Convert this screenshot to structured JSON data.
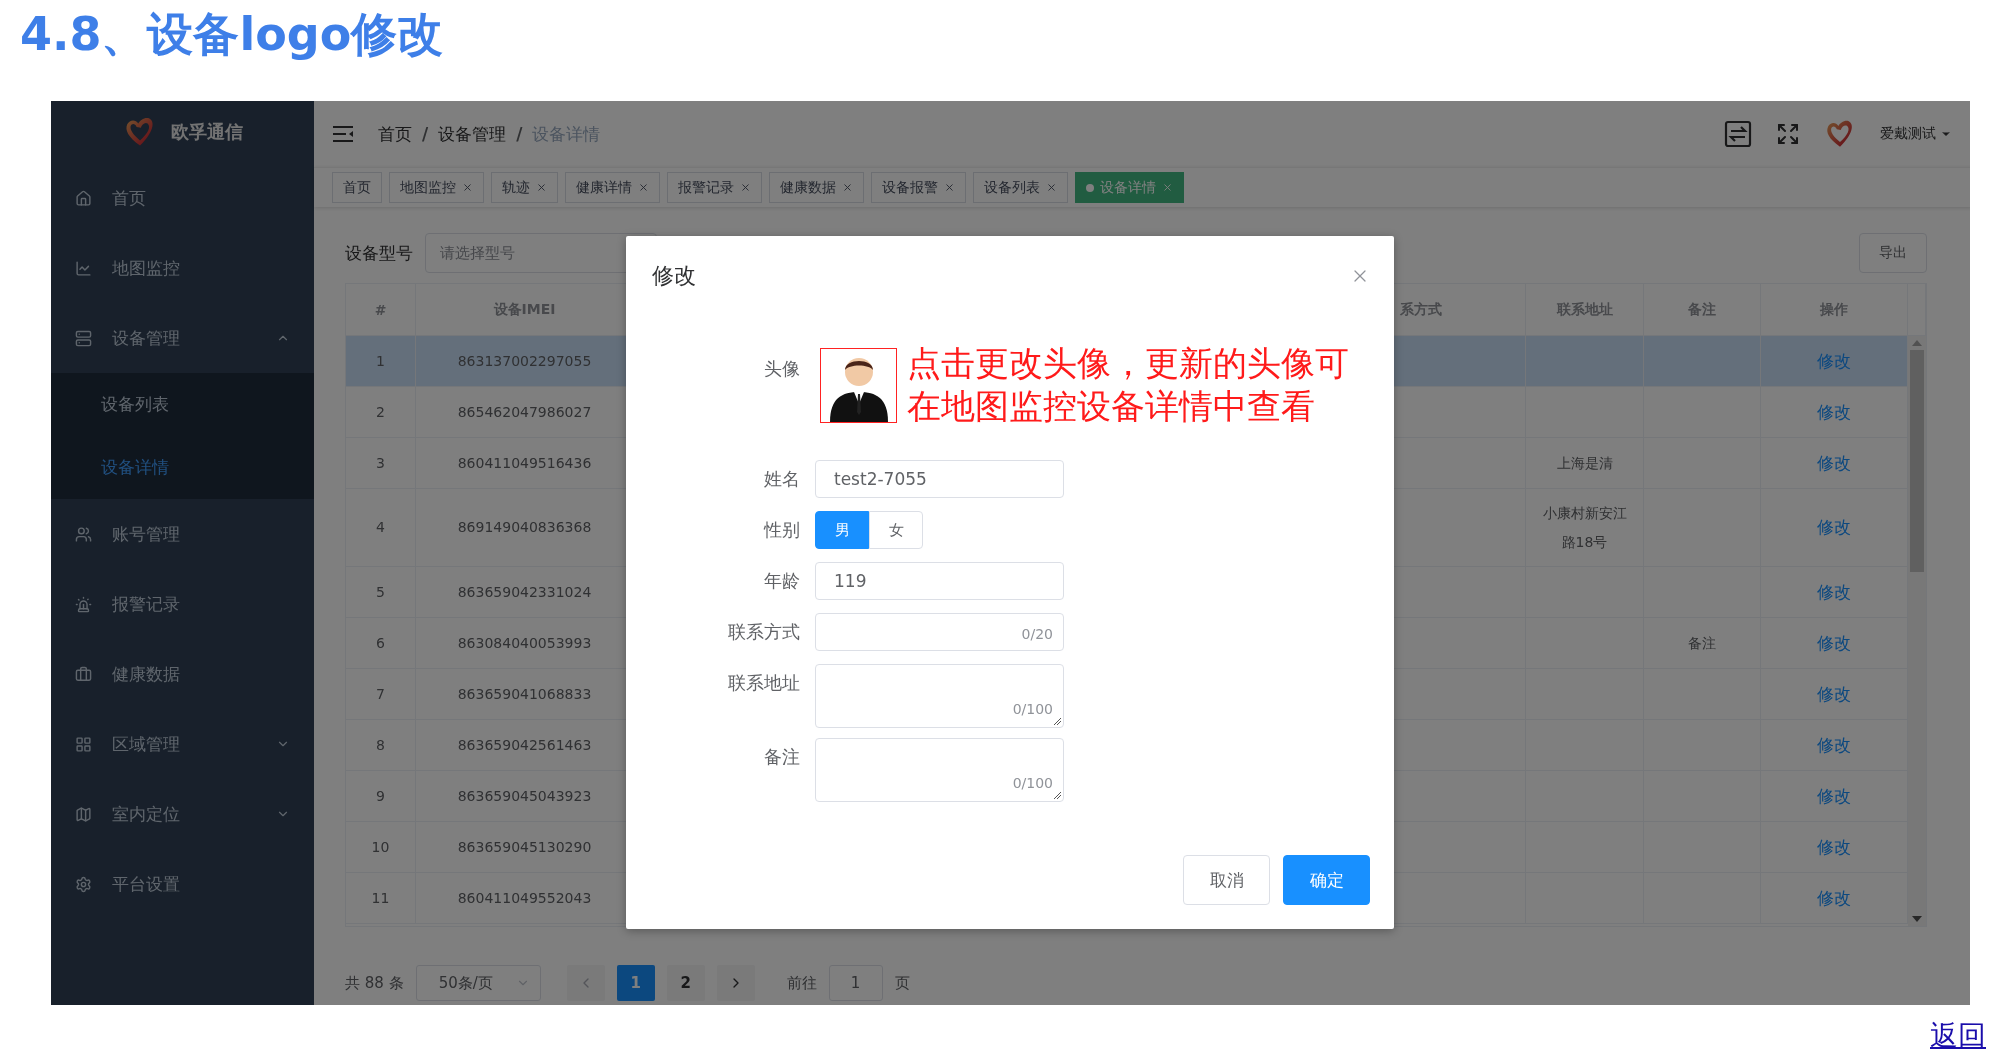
{
  "heading": "4.8、设备logo修改",
  "app": {
    "brand": "欧孚通信",
    "menu": [
      {
        "label": "首页",
        "selected": false
      },
      {
        "label": "地图监控",
        "selected": false
      },
      {
        "label": "设备管理",
        "selected": false,
        "expanded": true,
        "children": [
          {
            "label": "设备列表",
            "selected": false
          },
          {
            "label": "设备详情",
            "selected": true
          }
        ]
      },
      {
        "label": "账号管理",
        "selected": false
      },
      {
        "label": "报警记录",
        "selected": false
      },
      {
        "label": "健康数据",
        "selected": false
      },
      {
        "label": "区域管理",
        "selected": false,
        "expanded": false
      },
      {
        "label": "室内定位",
        "selected": false,
        "expanded": false
      },
      {
        "label": "平台设置",
        "selected": false
      }
    ],
    "breadcrumb": {
      "separator": "/",
      "items": [
        "首页",
        "设备管理",
        "设备详情"
      ]
    },
    "user": {
      "name": "爱戴测试"
    },
    "tabs": [
      {
        "label": "首页",
        "closable": false,
        "selected": false
      },
      {
        "label": "地图监控",
        "closable": true,
        "selected": false
      },
      {
        "label": "轨迹",
        "closable": true,
        "selected": false
      },
      {
        "label": "健康详情",
        "closable": true,
        "selected": false
      },
      {
        "label": "报警记录",
        "closable": true,
        "selected": false
      },
      {
        "label": "健康数据",
        "closable": true,
        "selected": false
      },
      {
        "label": "设备报警",
        "closable": true,
        "selected": false
      },
      {
        "label": "设备列表",
        "closable": true,
        "selected": false
      },
      {
        "label": "设备详情",
        "closable": true,
        "selected": true
      }
    ],
    "filter": {
      "label": "设备型号",
      "placeholder": "请选择型号"
    },
    "export_button": "导出",
    "table": {
      "columns": [
        "#",
        "设备IMEI",
        "系方式",
        "联系地址",
        "备注",
        "操作"
      ],
      "rows": [
        {
          "no": "1",
          "imei": "863137002297055",
          "action": "修改",
          "selected": true
        },
        {
          "no": "2",
          "imei": "865462047986027",
          "action": "修改",
          "selected": false
        },
        {
          "no": "3",
          "imei": "860411049516436",
          "address": "上海是清",
          "action": "修改",
          "selected": false
        },
        {
          "no": "4",
          "imei": "869149040836368",
          "address": "小康村新安江路18号",
          "action": "修改",
          "selected": false
        },
        {
          "no": "5",
          "imei": "863659042331024",
          "action": "修改",
          "selected": false
        },
        {
          "no": "6",
          "imei": "863084040053993",
          "note": "备注",
          "action": "修改",
          "selected": false
        },
        {
          "no": "7",
          "imei": "863659041068833",
          "action": "修改",
          "selected": false
        },
        {
          "no": "8",
          "imei": "863659042561463",
          "action": "修改",
          "selected": false
        },
        {
          "no": "9",
          "imei": "863659045043923",
          "action": "修改",
          "selected": false
        },
        {
          "no": "10",
          "imei": "863659045130290",
          "action": "修改",
          "selected": false
        },
        {
          "no": "11",
          "imei": "860411049552043",
          "action": "修改",
          "selected": false
        }
      ]
    },
    "pagination": {
      "total": "共 88 条",
      "page_size": "50条/页",
      "pages": [
        {
          "label": "1",
          "selected": true
        },
        {
          "label": "2",
          "selected": false
        }
      ],
      "goto_label": "前往",
      "goto_value": "1",
      "goto_suffix": "页"
    },
    "modal": {
      "title": "修改",
      "avatar_label": "头像",
      "annotation": "点击更改头像，更新的头像可在地图监控设备详情中查看",
      "fields": [
        {
          "kind": "text",
          "label": "姓名",
          "value": "test2-7055"
        },
        {
          "kind": "radio",
          "label": "性别",
          "options": [
            {
              "label": "男",
              "selected": true
            },
            {
              "label": "女",
              "selected": false
            }
          ]
        },
        {
          "kind": "text",
          "label": "年龄",
          "value": "119"
        },
        {
          "kind": "text",
          "label": "联系方式",
          "counter": "0/20"
        },
        {
          "kind": "textarea",
          "label": "联系地址",
          "counter": "0/100"
        },
        {
          "kind": "textarea",
          "label": "备注",
          "counter": "0/100"
        }
      ],
      "buttons": [
        {
          "label": "取消",
          "kind": "default"
        },
        {
          "label": "确定",
          "kind": "primary"
        }
      ]
    }
  },
  "back_link": "返回"
}
